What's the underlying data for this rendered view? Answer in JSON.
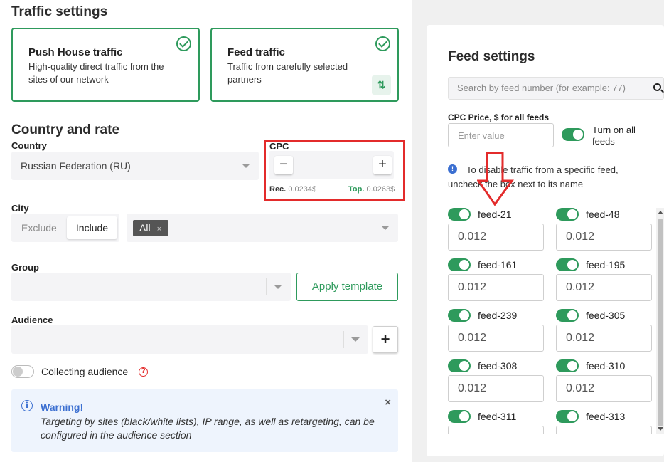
{
  "traffic": {
    "title": "Traffic settings",
    "cards": [
      {
        "title": "Push House traffic",
        "desc": "High-quality direct traffic from the sites of our network"
      },
      {
        "title": "Feed traffic",
        "desc": "Traffic from carefully selected partners"
      }
    ]
  },
  "country_rate": {
    "title": "Country and rate",
    "country_label": "Country",
    "country_value": "Russian Federation (RU)",
    "cpc_label": "CPC",
    "minus": "−",
    "plus": "+",
    "rec_label": "Rec.",
    "rec_value": "0.0234$",
    "top_label": "Top.",
    "top_value": "0.0263$"
  },
  "city": {
    "label": "City",
    "exclude": "Exclude",
    "include": "Include",
    "chip": "All",
    "chip_close": "×"
  },
  "group": {
    "label": "Group",
    "apply": "Apply template"
  },
  "audience": {
    "label": "Audience",
    "add": "+",
    "collecting": "Collecting audience",
    "help": "?"
  },
  "warning": {
    "icon": "i",
    "title": "Warning!",
    "text": "Targeting by sites (black/white lists), IP range, as well as retargeting, can be configured in the audience section",
    "close": "×"
  },
  "feed_settings": {
    "title": "Feed settings",
    "search_placeholder": "Search by feed number (for example: 77)",
    "cpc_all_label": "CPC Price, $ for all feeds",
    "enter_placeholder": "Enter value",
    "turn_on_all": "Turn on all feeds",
    "info_icon": "!",
    "info_text": "To disable traffic from a specific feed, uncheck the box next to its name",
    "feeds": [
      {
        "name": "feed-21",
        "value": "0.012",
        "on": true
      },
      {
        "name": "feed-48",
        "value": "0.012",
        "on": true
      },
      {
        "name": "feed-161",
        "value": "0.012",
        "on": true
      },
      {
        "name": "feed-195",
        "value": "0.012",
        "on": true
      },
      {
        "name": "feed-239",
        "value": "0.012",
        "on": true
      },
      {
        "name": "feed-305",
        "value": "0.012",
        "on": true
      },
      {
        "name": "feed-308",
        "value": "0.012",
        "on": true
      },
      {
        "name": "feed-310",
        "value": "0.012",
        "on": true
      },
      {
        "name": "feed-311",
        "value": "",
        "on": true
      },
      {
        "name": "feed-313",
        "value": "",
        "on": true
      }
    ]
  },
  "colors": {
    "accent": "#2e9a5c",
    "highlight": "#e32b2b",
    "info": "#3b6fd1"
  }
}
